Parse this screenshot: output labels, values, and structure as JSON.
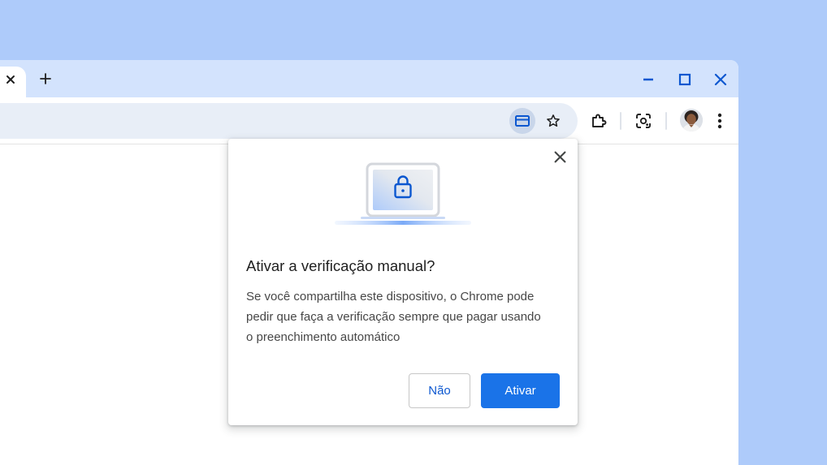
{
  "colors": {
    "background": "#aecbfa",
    "tabstrip": "#d3e3fd",
    "omnibox": "#e8eef7",
    "accent": "#0b57d0",
    "primary_button": "#1a73e8",
    "icon": "#1f1f1f"
  },
  "tabstrip": {
    "tab_close_icon": "close-icon",
    "new_tab_icon": "plus-icon",
    "window_controls": [
      "minimize-icon",
      "maximize-icon",
      "close-icon"
    ]
  },
  "toolbar": {
    "omnibox_icons": [
      "payment-card-icon",
      "star-icon"
    ],
    "right_icons": [
      "extensions-icon",
      "lens-icon",
      "avatar",
      "more-vert-icon"
    ]
  },
  "dialog": {
    "illustration": "laptop-lock-icon",
    "title": "Ativar a verificação manual?",
    "body_lines": [
      "Se você compartilha este dispositivo, o Chrome pode",
      "pedir que faça a verificação sempre que pagar usando",
      "o preenchimento automático"
    ],
    "secondary_button": "Não",
    "primary_button": "Ativar"
  }
}
